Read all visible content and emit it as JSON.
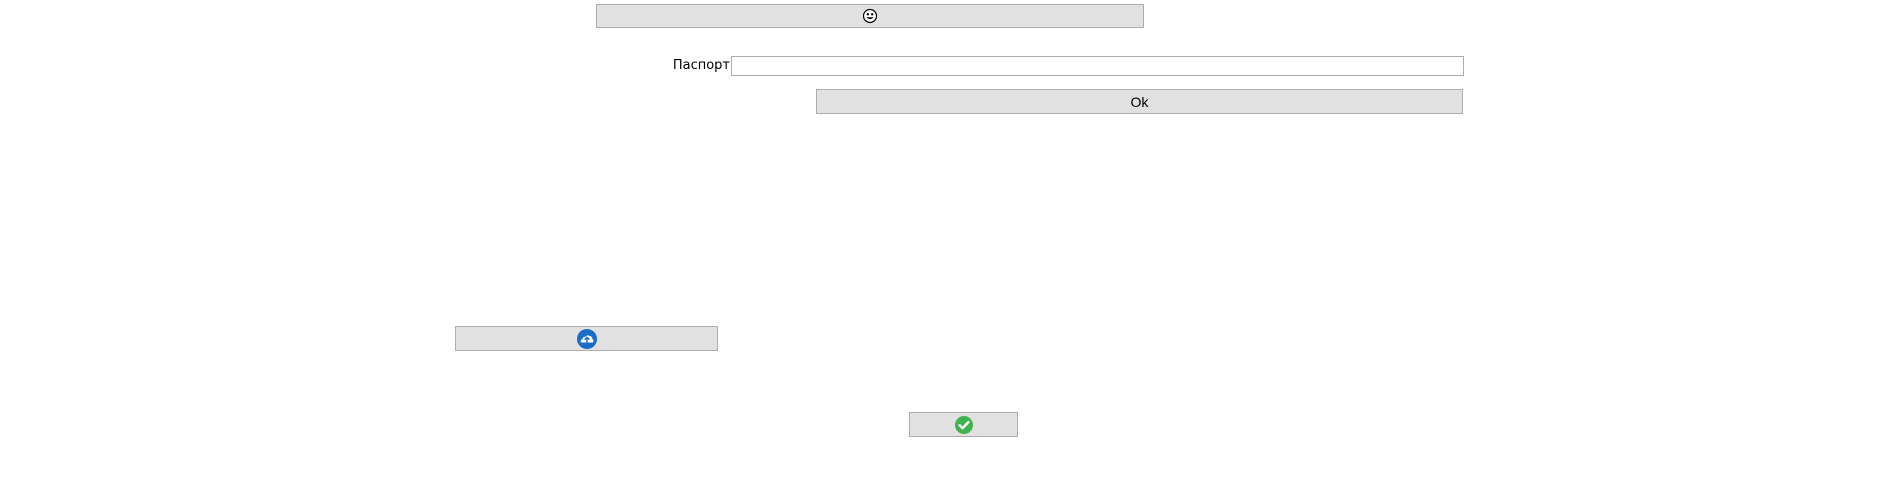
{
  "top_button": {
    "icon": "smiley-icon"
  },
  "passport": {
    "label": "Паспорт",
    "value": "",
    "placeholder": ""
  },
  "ok_button": {
    "label": "Ok"
  },
  "cloud_button": {
    "icon": "cloud-upload-icon",
    "accent": "#1a6fc4"
  },
  "confirm_button": {
    "icon": "checkmark-icon",
    "accent": "#3fb34f"
  }
}
